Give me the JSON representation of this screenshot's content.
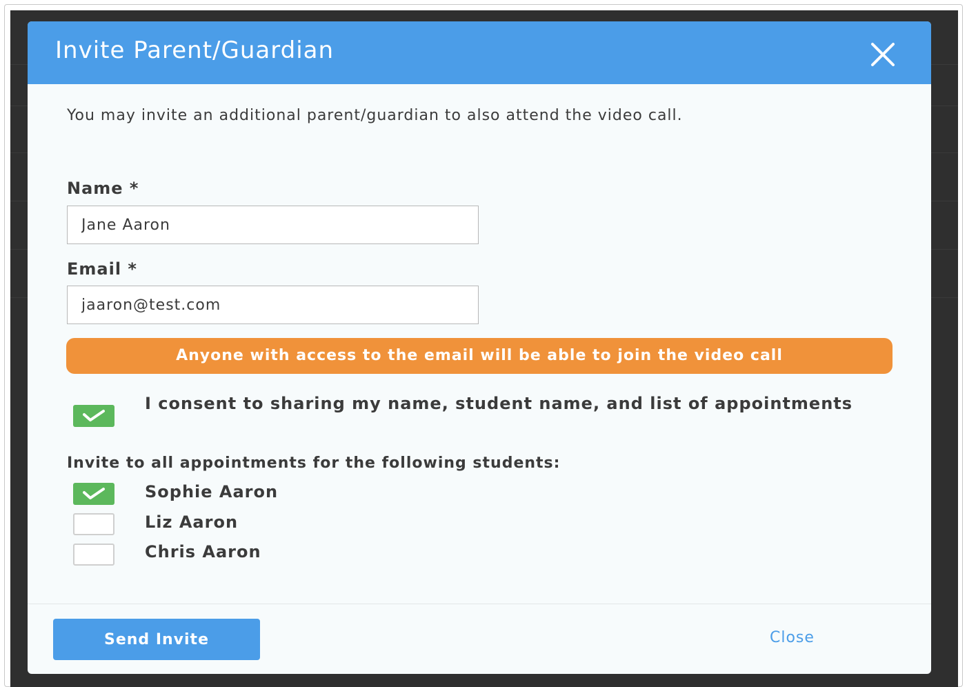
{
  "modal": {
    "title": "Invite Parent/Guardian",
    "close_icon": "close-icon",
    "intro_text": "You may invite an additional parent/guardian to also attend the video call."
  },
  "form": {
    "name_label": "Name *",
    "name_value": "Jane Aaron",
    "email_label": "Email *",
    "email_value": "jaaron@test.com"
  },
  "warning": {
    "text": "Anyone with access to the email will be able to join the video call",
    "color": "#f0923a"
  },
  "consent": {
    "checked": true,
    "text": "I consent to sharing my name, student name, and list of appointments"
  },
  "students": {
    "heading": "Invite to all appointments for the following students:",
    "items": [
      {
        "name": "Sophie Aaron",
        "checked": true
      },
      {
        "name": "Liz Aaron",
        "checked": false
      },
      {
        "name": "Chris Aaron",
        "checked": false
      }
    ]
  },
  "footer": {
    "send_label": "Send Invite",
    "close_label": "Close"
  },
  "colors": {
    "header": "#4b9de8",
    "checkbox_checked": "#5cb85c",
    "primary_button": "#4b9de8"
  }
}
